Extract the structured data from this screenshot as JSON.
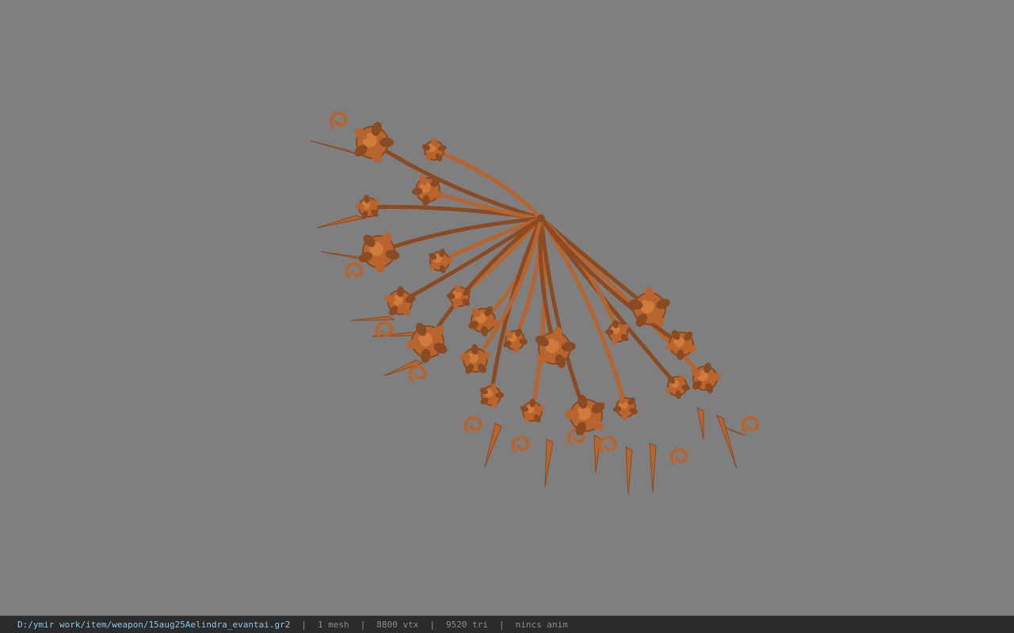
{
  "viewport": {
    "background": "#7f7f7f",
    "model_color": "#b8642e",
    "model_shade": "#8a4a22",
    "model_highlight": "#d07a3c"
  },
  "statusbar": {
    "file_path": "D:/ymir work/item/weapon/15aug25Aelindra_evantai.gr2",
    "mesh_count": "1 mesh",
    "vertex_count": "8800 vtx",
    "triangle_count": "9520 tri",
    "anim": "nincs anim",
    "separator": "|"
  }
}
